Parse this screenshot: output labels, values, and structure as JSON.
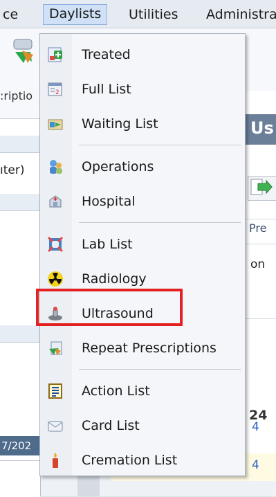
{
  "menubar": {
    "items": [
      {
        "label": "ce"
      },
      {
        "label": "Daylists"
      },
      {
        "label": "Utilities"
      },
      {
        "label": "Administra"
      }
    ]
  },
  "background": {
    "toolbar_label": ":riptio",
    "toolbar_v": "V",
    "left_panel_text_1": "ıter)",
    "left_panel_date": "7/202",
    "right_header": "Us",
    "right_tab": "Pre",
    "right_on": "on",
    "right_24": "24",
    "right_4a": "4",
    "right_4b": "4"
  },
  "menu": {
    "groups": [
      [
        {
          "label": "Treated",
          "icon": "treated-icon"
        },
        {
          "label": "Full List",
          "icon": "full-list-icon"
        },
        {
          "label": "Waiting List",
          "icon": "waiting-list-icon"
        }
      ],
      [
        {
          "label": "Operations",
          "icon": "operations-icon"
        },
        {
          "label": "Hospital",
          "icon": "hospital-icon"
        }
      ],
      [
        {
          "label": "Lab List",
          "icon": "lab-list-icon"
        },
        {
          "label": "Radiology",
          "icon": "radiation-icon"
        },
        {
          "label": "Ultrasound",
          "icon": "ultrasound-icon"
        },
        {
          "label": "Repeat Prescriptions",
          "icon": "repeat-prescriptions-icon"
        }
      ],
      [
        {
          "label": "Action List",
          "icon": "action-list-icon"
        },
        {
          "label": "Card List",
          "icon": "card-list-icon"
        },
        {
          "label": "Cremation List",
          "icon": "cremation-candle-icon"
        }
      ]
    ]
  },
  "colors": {
    "highlight": "#e32121",
    "menubar_active": "#cfe0f7",
    "link": "#2b60c6"
  }
}
